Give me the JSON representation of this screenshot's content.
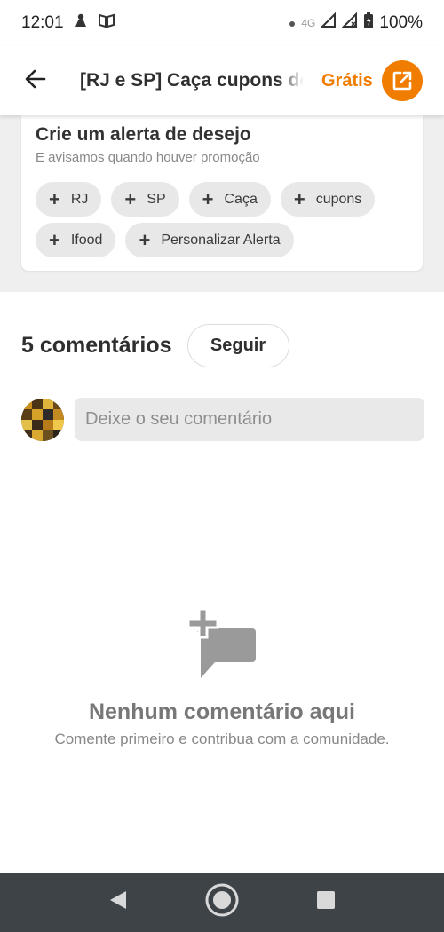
{
  "status_bar": {
    "time": "12:01",
    "network": "4G",
    "battery": "100%"
  },
  "header": {
    "title": "[RJ e SP] Caça cupons do Ifood",
    "cta_label": "Grátis",
    "back_icon": "arrow-left-icon",
    "cta_icon": "open-external-icon"
  },
  "alert": {
    "title": "Crie um alerta de desejo",
    "subtitle": "E avisamos quando houver promoção",
    "chips": [
      "RJ",
      "SP",
      "Caça",
      "cupons",
      "Ifood",
      "Personalizar Alerta"
    ]
  },
  "comments": {
    "count_label": "5 comentários",
    "follow_label": "Seguir",
    "input_placeholder": "Deixe o seu comentário"
  },
  "empty_state": {
    "icon": "add-comment-icon",
    "title": "Nenhum comentário aqui",
    "description": "Comente primeiro e contribua com a comunidade."
  },
  "colors": {
    "accent": "#f07c00",
    "nav_bar": "#3d4347",
    "section_bg": "#efefef",
    "chip_bg": "#e8e8e8"
  }
}
